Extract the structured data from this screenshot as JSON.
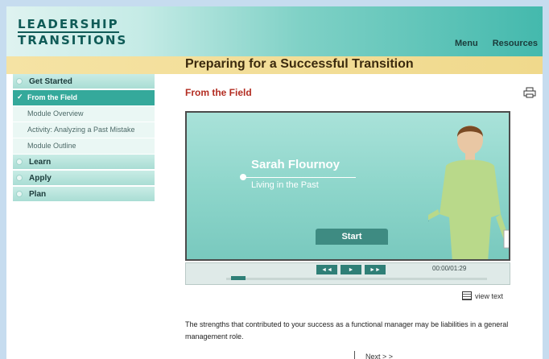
{
  "header": {
    "logo_line1": "LEADERSHIP",
    "logo_line2": "TRANSITIONS",
    "nav": [
      "Menu",
      "Resources"
    ]
  },
  "title": "Preparing for a Successful Transition",
  "sidebar": {
    "sections": [
      {
        "label": "Get Started"
      },
      {
        "label": "Learn"
      },
      {
        "label": "Apply"
      },
      {
        "label": "Plan"
      }
    ],
    "get_started_items": [
      {
        "label": "From the Field",
        "active": true
      },
      {
        "label": "Module Overview"
      },
      {
        "label": "Activity: Analyzing a Past Mistake"
      },
      {
        "label": "Module Outline"
      }
    ]
  },
  "main": {
    "section_title": "From the Field",
    "video": {
      "name": "Sarah Flournoy",
      "subtitle": "Living in the Past",
      "start_label": "Start",
      "rewind_label": "◄◄",
      "play_label": "►",
      "forward_label": "►►",
      "timecode": "00:00/01:29",
      "progress": 0.0
    },
    "view_text_label": "view text",
    "body": "The strengths that contributed to your success as a functional manager may be liabilities in a general management role."
  },
  "footer": {
    "next_label": "Next > >"
  },
  "colors": {
    "accent": "#35a99b",
    "title_bar": "#f0d98c",
    "section_title": "#b32d22"
  }
}
